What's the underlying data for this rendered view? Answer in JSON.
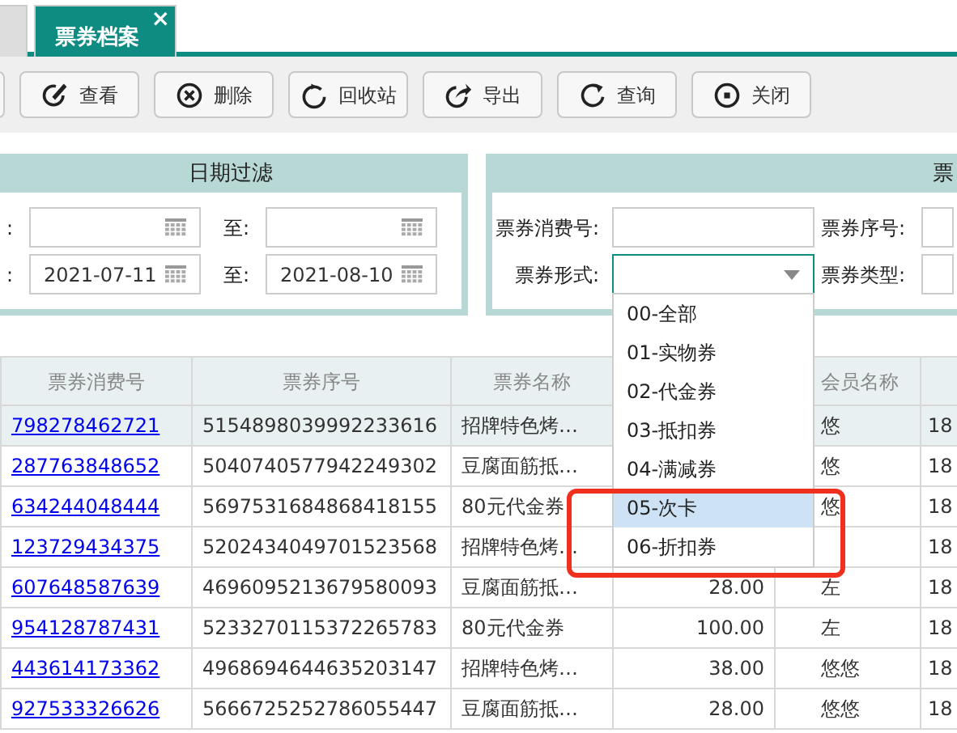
{
  "tabs": [
    {
      "selected": false
    },
    {
      "label": "票券档案",
      "selected": true,
      "close": "×"
    }
  ],
  "toolbar": [
    {
      "label": "查看"
    },
    {
      "label": "删除"
    },
    {
      "label": "回收站"
    },
    {
      "label": "导出"
    },
    {
      "label": "查询"
    },
    {
      "label": "关闭"
    }
  ],
  "date_filter": {
    "title": "日期过滤",
    "rows": [
      {
        "label": ":",
        "from": "",
        "to_label": "至:",
        "to": ""
      },
      {
        "label": ":",
        "from": "2021-07-11",
        "to_label": "至:",
        "to": "2021-08-10"
      }
    ]
  },
  "ticket_filter": {
    "title": "票",
    "fields": [
      {
        "label": "票券消费号:",
        "kind": "text"
      },
      {
        "label": "票券序号:",
        "kind": "text"
      },
      {
        "label": "票券形式:",
        "kind": "select",
        "focused": true
      },
      {
        "label": "票券类型:",
        "kind": "text"
      }
    ]
  },
  "dropdown": {
    "options": [
      {
        "label": "00-全部",
        "selected": false
      },
      {
        "label": "01-实物券",
        "selected": false
      },
      {
        "label": "02-代金券",
        "selected": false
      },
      {
        "label": "03-抵扣券",
        "selected": false
      },
      {
        "label": "04-满减券",
        "selected": false
      },
      {
        "label": "05-次卡",
        "selected": true
      },
      {
        "label": "06-折扣券",
        "selected": false
      }
    ]
  },
  "table": {
    "columns": [
      "票券消费号",
      "票券序号",
      "票券名称",
      "",
      "会员名称",
      ""
    ],
    "rows": [
      {
        "selected": true,
        "cells": [
          "798278462721",
          "5154898039992233616",
          "招牌特色烤…",
          "",
          "悠",
          "18"
        ]
      },
      {
        "selected": false,
        "cells": [
          "287763848652",
          "5040740577942249302",
          "豆腐面筋抵…",
          "",
          "悠",
          "18"
        ]
      },
      {
        "selected": false,
        "cells": [
          "634244048444",
          "5697531684868418155",
          "80元代金券",
          "",
          "悠",
          "18"
        ]
      },
      {
        "selected": false,
        "cells": [
          "123729434375",
          "5202434049701523568",
          "招牌特色烤…",
          "",
          "",
          "18"
        ]
      },
      {
        "selected": false,
        "cells": [
          "607648587639",
          "4696095213679580093",
          "豆腐面筋抵…",
          "28.00",
          "左",
          "18"
        ]
      },
      {
        "selected": false,
        "cells": [
          "954128787431",
          "5233270115372265783",
          "80元代金券",
          "100.00",
          "左",
          "18"
        ]
      },
      {
        "selected": false,
        "cells": [
          "443614173362",
          "4968694644635203147",
          "招牌特色烤…",
          "38.00",
          "悠悠",
          "18"
        ]
      },
      {
        "selected": false,
        "cells": [
          "927533326626",
          "5666725252786055447",
          "豆腐面筋抵…",
          "28.00",
          "悠悠",
          "18"
        ]
      }
    ]
  }
}
